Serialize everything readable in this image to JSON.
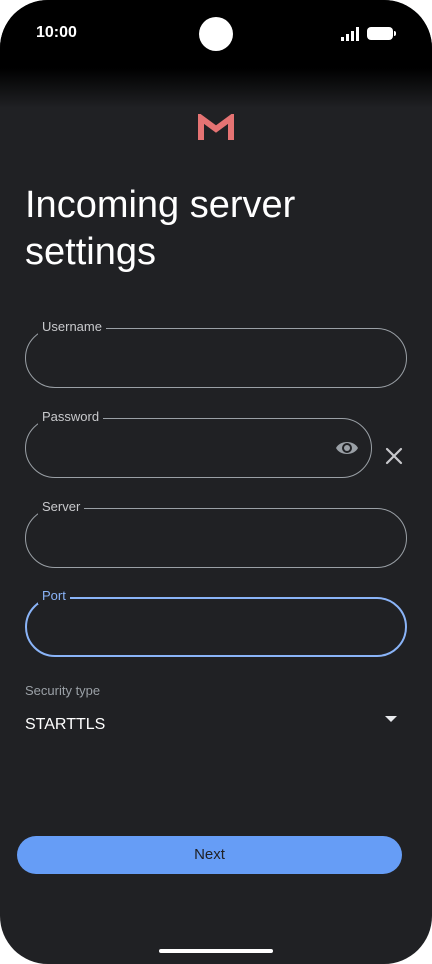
{
  "status": {
    "time": "10:00"
  },
  "title": "Incoming server settings",
  "fields": {
    "username": {
      "label": "Username",
      "value": ""
    },
    "password": {
      "label": "Password",
      "value": ""
    },
    "server": {
      "label": "Server",
      "value": ""
    },
    "port": {
      "label": "Port",
      "value": ""
    }
  },
  "security": {
    "label": "Security type",
    "value": "STARTTLS"
  },
  "next_label": "Next",
  "colors": {
    "accent": "#8ab4f8",
    "button": "#669df6",
    "background": "#202124",
    "logo": "#e57373"
  },
  "icons": [
    "signal-icon",
    "battery-icon",
    "gmail-logo",
    "eye-icon",
    "close-icon",
    "dropdown-arrow-icon"
  ]
}
